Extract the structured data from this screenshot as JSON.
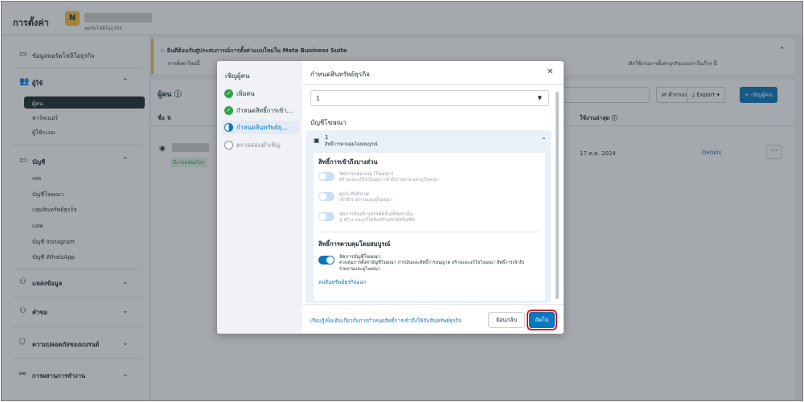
{
  "header": {
    "title": "การตั้งค่า",
    "avatar_letter": "N",
    "portfolio_sub": "พอร์ตโฟลิโอธุรกิจ"
  },
  "sidebar": {
    "business_info": "ข้อมูลพอร์ตโฟลิโอธุรกิจ",
    "users": {
      "label": "ผู้ใช้",
      "items": [
        "ผู้คน",
        "พาร์ทเนอร์",
        "ผู้ใช้ระบบ"
      ]
    },
    "accounts": {
      "label": "บัญชี",
      "items": [
        "เพจ",
        "บัญชีโฆษณา",
        "กลุ่มสินทรัพย์ธุรกิจ",
        "แอพ",
        "บัญชี Instagram",
        "บัญชี WhatsApp"
      ]
    },
    "data_sources": "แหล่งข้อมูล",
    "requests": "คำขอ",
    "brand_safety": "ความปลอดภัยของแบรนด์",
    "integrations": "การผสานการทำงาน"
  },
  "banner": {
    "title": "ยินดีต้อนรับสู่ประสบการณ์การตั้งค่าแบบใหม่ใน Meta Business Suite",
    "text": "การตั้งค่าใหม่นี้",
    "text_right": "เลิกใช้งานการตั้งค่าธุรกิจแบบเก่าในเร็วๆ นี้"
  },
  "main": {
    "title": "ผู้คน",
    "filter_label": "ตัวกรอง",
    "export_label": "Export",
    "invite_label": "+ เชิญผู้คน",
    "col_name": "ชื่อ",
    "col_last_active": "ใช้งานล่าสุด",
    "row": {
      "badge": "มีงานคล้อยไหว",
      "date": "17 ต.ค. 2024",
      "details": "Details"
    }
  },
  "modal": {
    "left_title": "เชิญผู้คน",
    "steps": [
      {
        "label": "เพิ่มคน",
        "state": "done"
      },
      {
        "label": "กำหนดสิทธิ์การเข้า...",
        "state": "done"
      },
      {
        "label": "กำหนดสินทรัพย์ธุ...",
        "state": "current"
      },
      {
        "label": "ตรวจสอบคำเชิญ",
        "state": "pending"
      }
    ],
    "title": "กำหนดสินทรัพย์ธุรกิจ",
    "select_value": "1",
    "section_heading": "บัญชีโฆษณา",
    "account": {
      "number": "1",
      "subtitle": "สิทธิ์การควบคุมโดยสมบูรณ์"
    },
    "partial_heading": "สิทธิ์การเข้าถึงบางส่วน",
    "partial_perms": [
      {
        "title": "จัดการแคมเปญ (โฆษณา)",
        "desc": "สร้างและแก้ไขโฆษณา เข้าถึงรายงาน และดูโฆษณา"
      },
      {
        "title": "ดูประสิทธิภาพ",
        "desc": "เข้าถึงรายงานและดูโฆษณา"
      },
      {
        "title": "จัดการข้อสร้างสรรค์ครีเอทีฟเท่านั้น",
        "desc": "ดู สร้าง และแก้ไขข้อสร้างสรรค์ครีเอทีฟ"
      }
    ],
    "full_heading": "สิทธิ์การควบคุมโดยสมบูรณ์",
    "full_perm": {
      "title": "จัดการบัญชีโฆษณา",
      "desc_line1": "ควบคุมการตั้งค่าบัญชีโฆษณา การเงินและสิทธิ์การอนุญาต สร้างและแก้ไขโฆษณา สิทธิ์การเข้าถึง",
      "desc_line2": "รายงานและดูโฆษณา"
    },
    "remove_link": "ลบสินทรัพย์ธุรกิจออก",
    "learn_link": "เรียนรู้เพิ่มเติมเกี่ยวกับการกำหนดสิทธิ์การเข้าถึงให้กับสินทรัพย์ธุรกิจ",
    "back_label": "ย้อนกลับ",
    "next_label": "ถัดไป"
  },
  "colors": {
    "accent": "#0a78be",
    "highlight_border": "#d81e1e",
    "success": "#31a24c"
  }
}
